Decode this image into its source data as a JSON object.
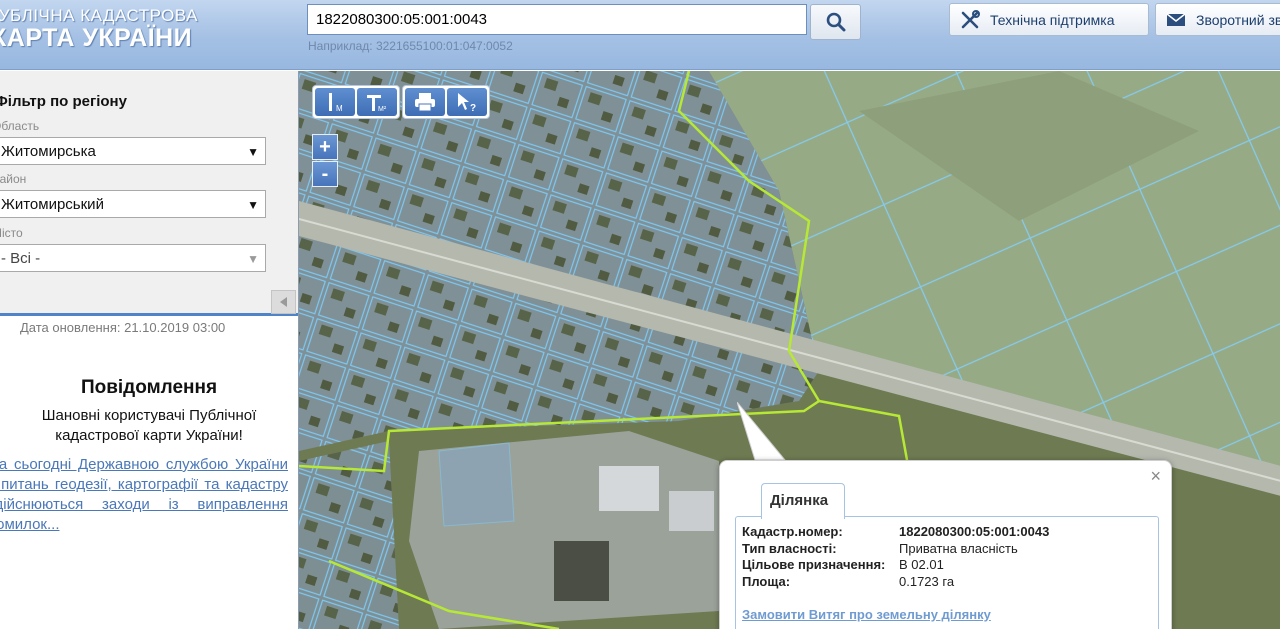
{
  "header": {
    "logo_line1": "ПУБЛІЧНА КАДАСТРОВА",
    "logo_line2": "КАРТА УКРАЇНИ",
    "search_value": "1822080300:05:001:0043",
    "search_hint": "Наприклад: 3221655100:01:047:0052",
    "support_label": "Технічна підтримка",
    "feedback_label": "Зворотний зв"
  },
  "sidebar": {
    "filter_title": "Фільтр по регіону",
    "region_label": "Область",
    "region_value": "Житомирська",
    "district_label": "Район",
    "district_value": "Житомирський",
    "city_label": "Місто",
    "city_value": "- Всі -",
    "update_date": "Дата оновлення: 21.10.2019 03:00",
    "notice_title": "Повідомлення",
    "notice_body": "Шановні користувачі Публічної кадастрової карти України!",
    "notice_link": "На сьогодні Державною службою України з питань геодезії, картографії та кадастру здійснюються заходи із виправлення помилок..."
  },
  "map_tools": [
    {
      "name": "ruler-length-icon",
      "sub": "M"
    },
    {
      "name": "ruler-area-icon",
      "sub": "M²"
    },
    {
      "name": "print-icon",
      "sub": ""
    },
    {
      "name": "identify-pointer-icon",
      "sub": "?"
    }
  ],
  "zoom": {
    "in": "+",
    "out": "-"
  },
  "popup": {
    "tab_label": "Ділянка",
    "close_symbol": "×",
    "rows": [
      {
        "key": "Кадастр.номер:",
        "value": "1822080300:05:001:0043"
      },
      {
        "key": "Тип власності:",
        "value": "Приватна власність"
      },
      {
        "key": "Цільове призначення:",
        "value": "В 02.01"
      },
      {
        "key": "Площа:",
        "value": "0.1723 га"
      }
    ],
    "order_link": "Замовити Витяг про земельну ділянку"
  },
  "colors": {
    "parcel_outline": "#7ec8f2",
    "boundary_line": "#b6e835",
    "accent_blue": "#4f84c8"
  }
}
